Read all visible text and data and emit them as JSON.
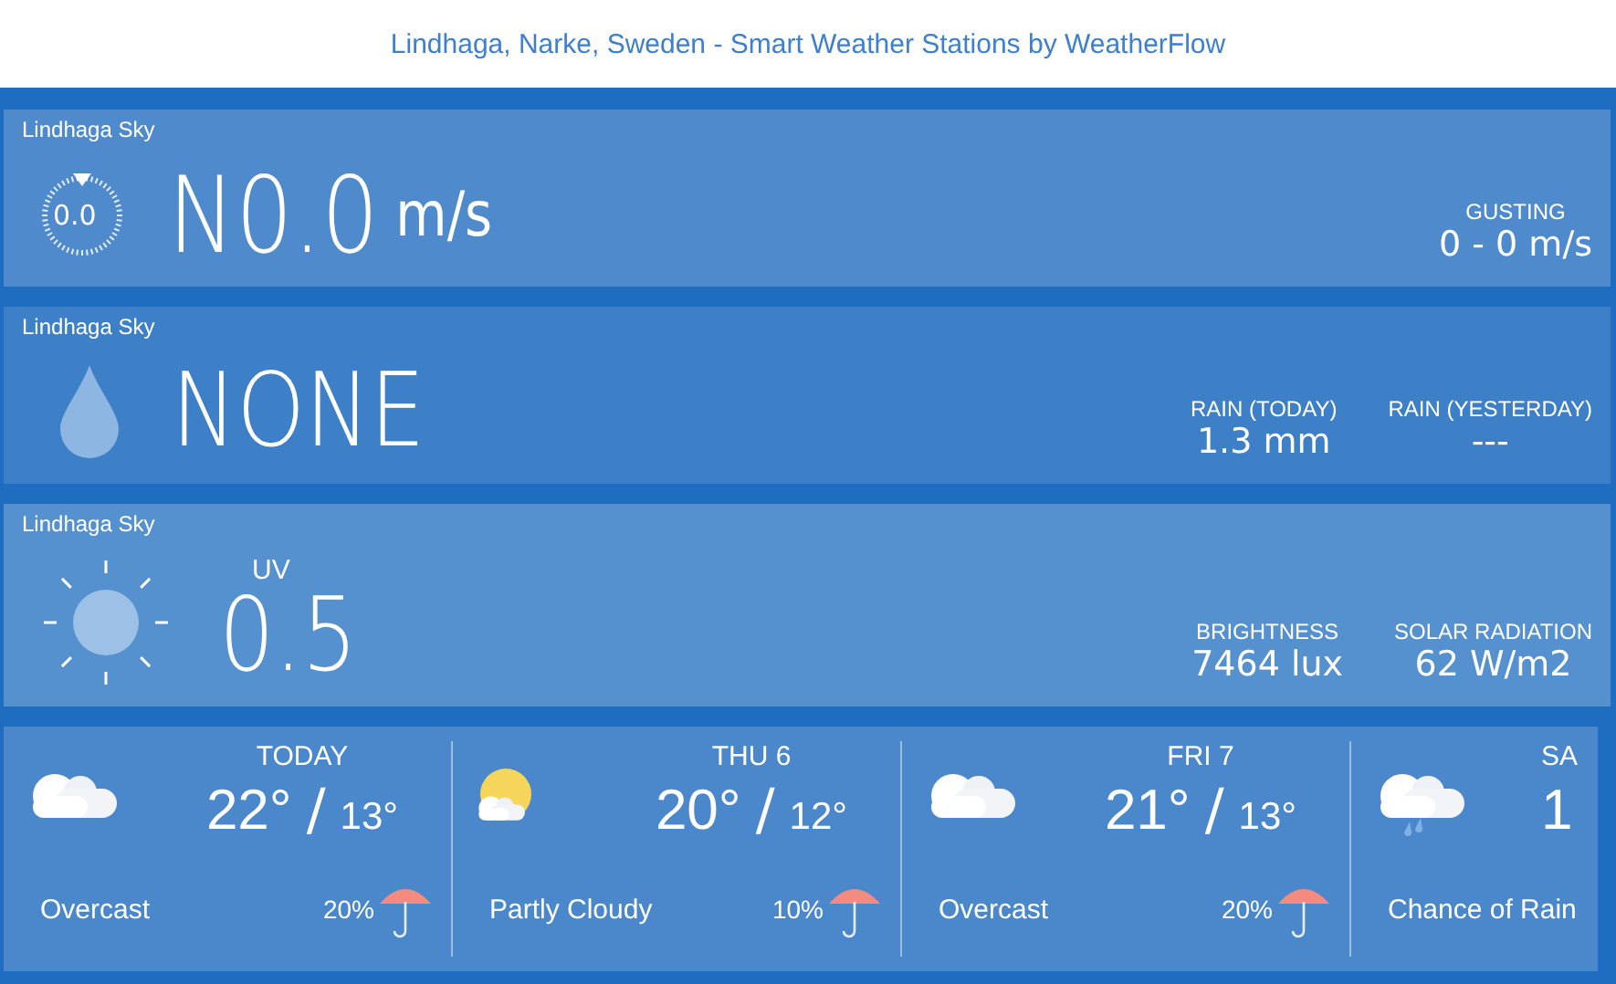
{
  "header": {
    "title": "Lindhaga, Narke, Sweden - Smart Weather Stations by WeatherFlow"
  },
  "wind": {
    "station": "Lindhaga Sky",
    "dial_value": "0.0",
    "direction": "N",
    "speed": "0.0",
    "unit": "m/s",
    "stats": [
      {
        "label": "GUSTING",
        "value": "0 - 0 m/s"
      }
    ]
  },
  "rain": {
    "station": "Lindhaga Sky",
    "amount": "NONE",
    "stats": [
      {
        "label": "RAIN (TODAY)",
        "value": "1.3 mm"
      },
      {
        "label": "RAIN (YESTERDAY)",
        "value": "---"
      }
    ]
  },
  "sun": {
    "station": "Lindhaga Sky",
    "uv_label": "UV",
    "uv": "0.5",
    "stats": [
      {
        "label": "BRIGHTNESS",
        "value": "7464 lux"
      },
      {
        "label": "SOLAR RADIATION",
        "value": "62 W/m2"
      }
    ]
  },
  "forecast": [
    {
      "day": "TODAY",
      "kind": "cloudy",
      "high": "22°",
      "separator": "/",
      "low": "13°",
      "condition": "Overcast",
      "precip": "20%"
    },
    {
      "day": "THU 6",
      "kind": "partly-cloudy",
      "high": "20°",
      "separator": "/",
      "low": "12°",
      "condition": "Partly Cloudy",
      "precip": "10%"
    },
    {
      "day": "FRI 7",
      "kind": "cloudy",
      "high": "21°",
      "separator": "/",
      "low": "13°",
      "condition": "Overcast",
      "precip": "20%"
    },
    {
      "day": "SA",
      "kind": "rain",
      "high": "1",
      "condition": "Chance of Rain"
    }
  ]
}
